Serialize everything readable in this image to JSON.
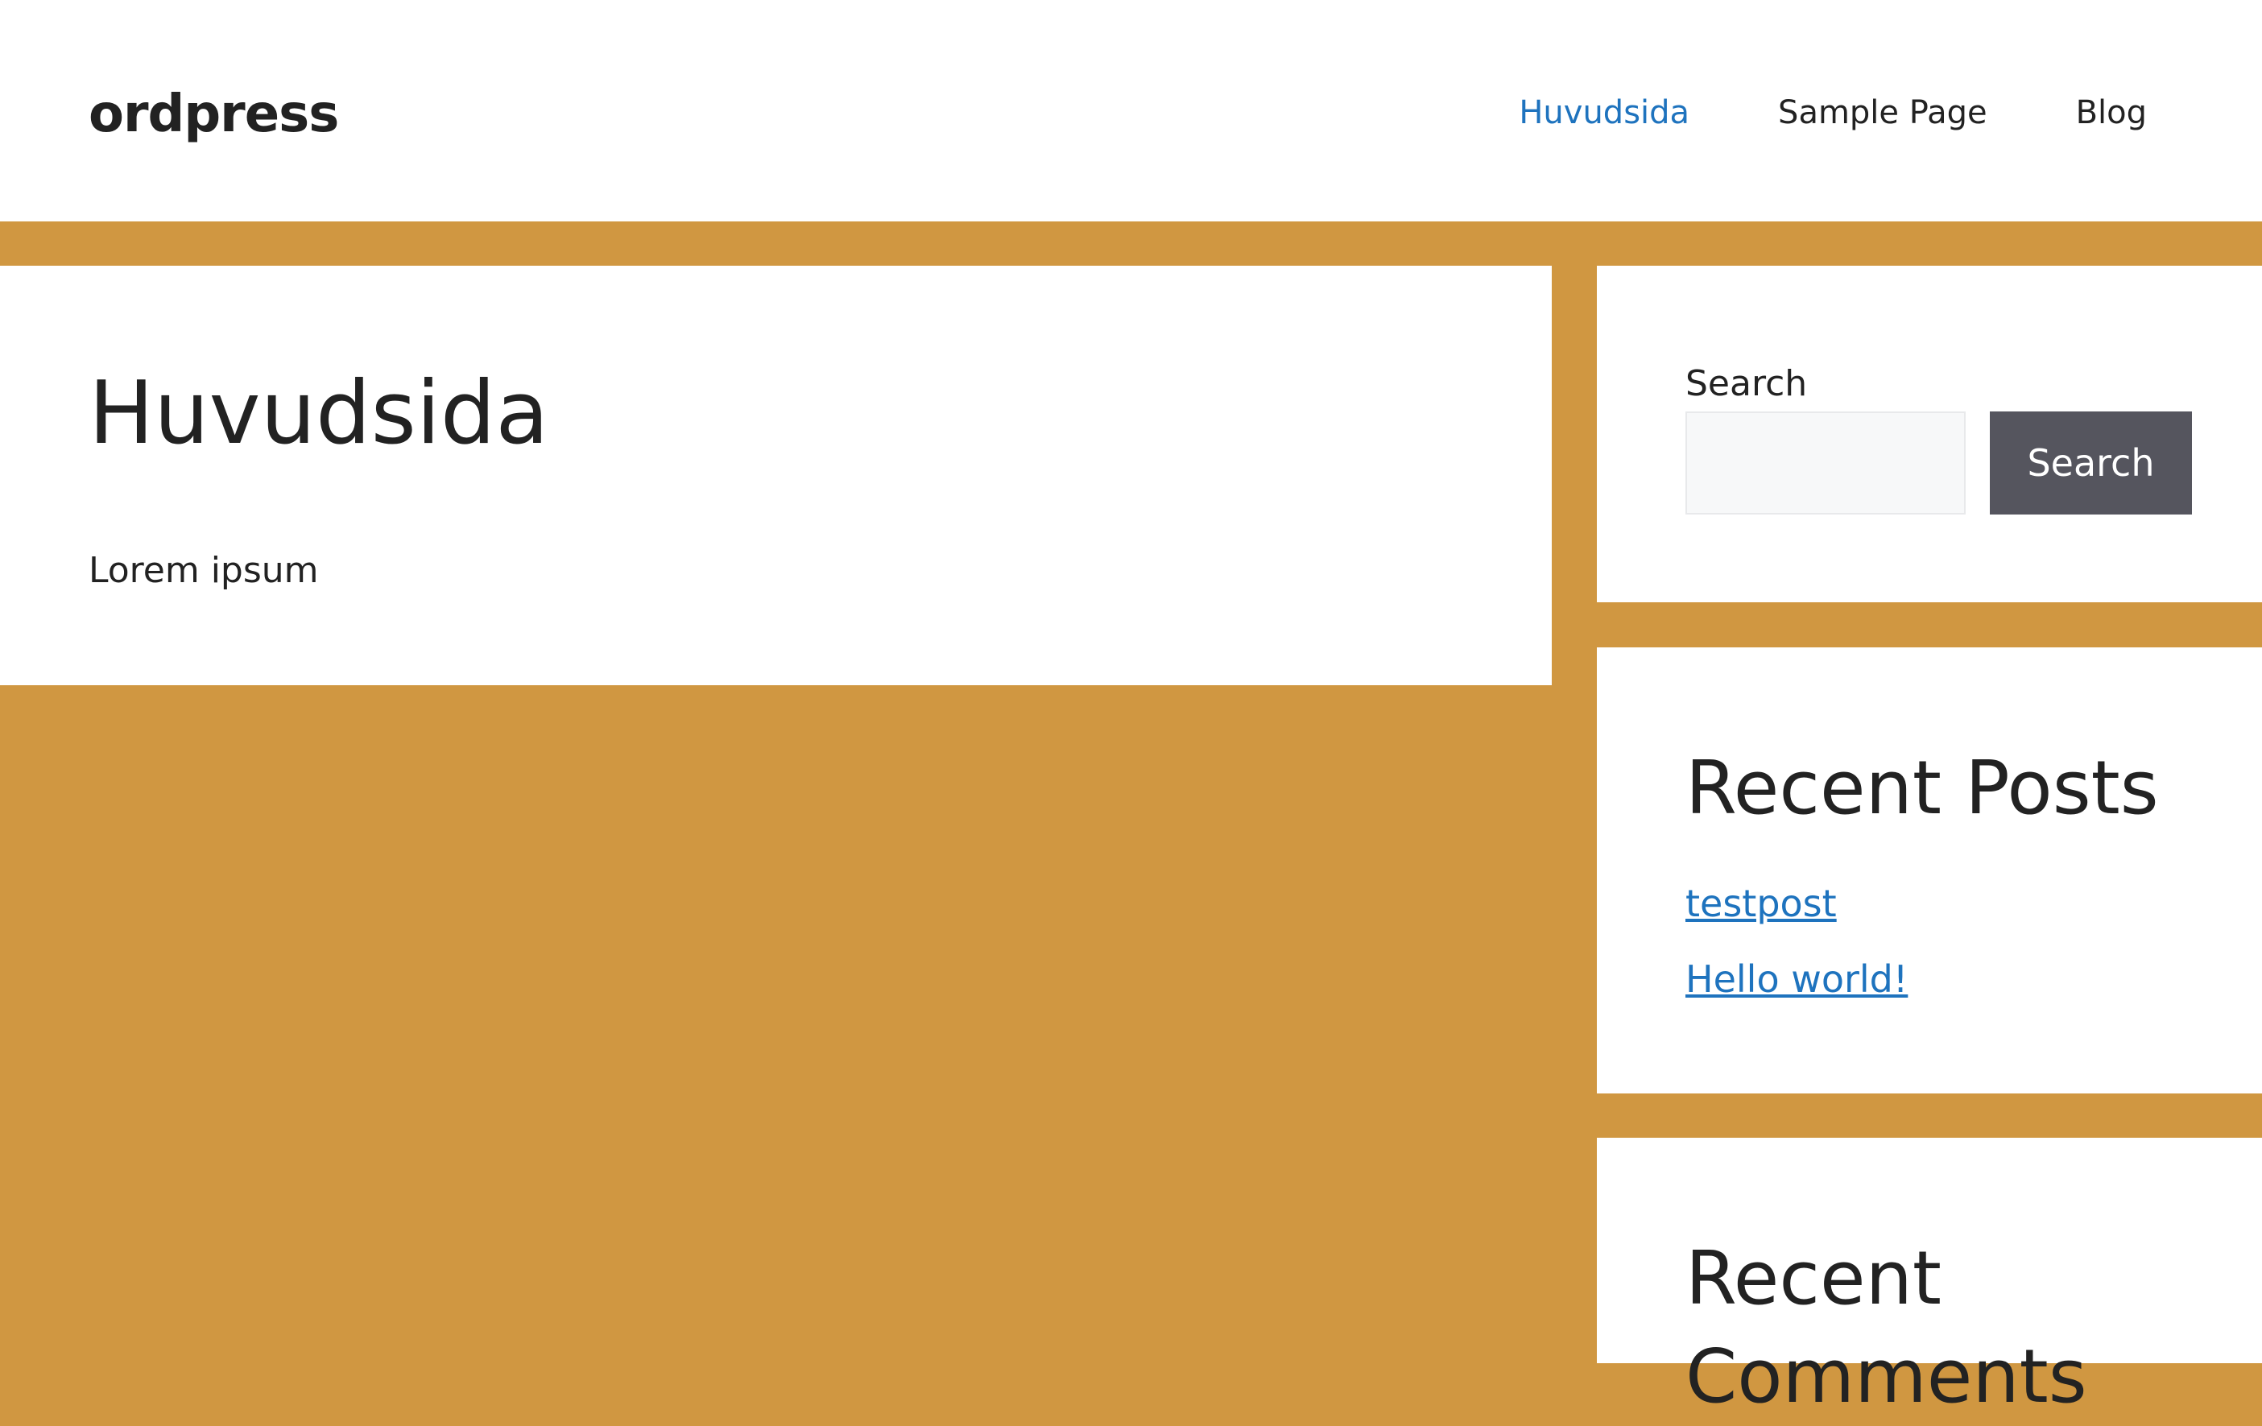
{
  "header": {
    "site_title": "ordpress",
    "nav": [
      {
        "label": "Huvudsida",
        "current": true
      },
      {
        "label": "Sample Page",
        "current": false
      },
      {
        "label": "Blog",
        "current": false
      }
    ]
  },
  "main": {
    "title": "Huvudsida",
    "text": "Lorem ipsum"
  },
  "sidebar": {
    "search": {
      "label": "Search",
      "input_value": "",
      "button_label": "Search"
    },
    "recent_posts": {
      "title": "Recent Posts",
      "items": [
        "testpost",
        "Hello world!"
      ]
    },
    "recent_comments": {
      "title": "Recent Comments"
    }
  },
  "colors": {
    "background": "#d09741",
    "link": "#1e73be",
    "button": "#55555e",
    "text": "#222222"
  }
}
